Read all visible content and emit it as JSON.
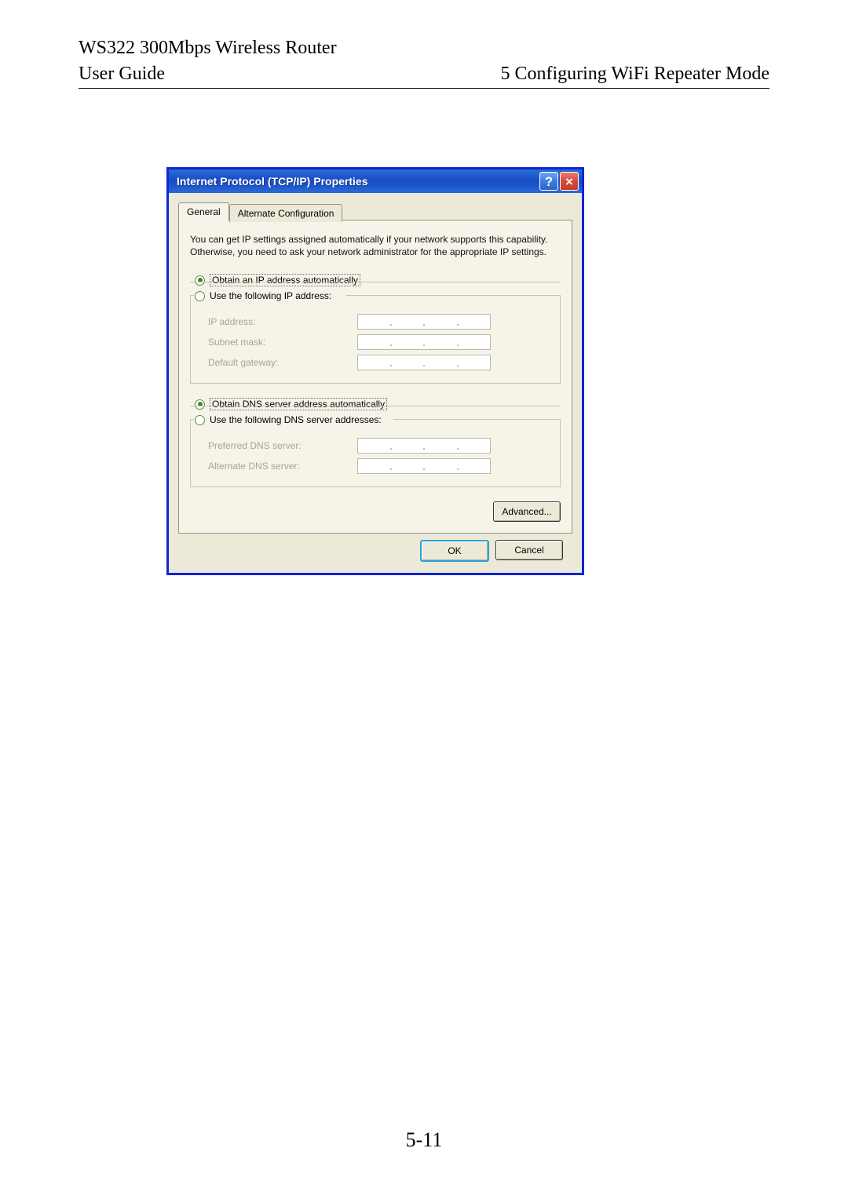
{
  "page": {
    "title_line": "WS322 300Mbps Wireless Router",
    "left_header": "User Guide",
    "right_header": "5 Configuring WiFi Repeater Mode",
    "page_number": "5-11"
  },
  "dialog": {
    "title": "Internet Protocol (TCP/IP) Properties",
    "tabs": {
      "general": "General",
      "alt": "Alternate Configuration"
    },
    "description": "You can get IP settings assigned automatically if your network supports this capability. Otherwise, you need to ask your network administrator for the appropriate IP settings.",
    "ip_group": {
      "auto": "Obtain an IP address automatically",
      "manual": "Use the following IP address:",
      "fields": {
        "ip": "IP address:",
        "mask": "Subnet mask:",
        "gateway": "Default gateway:"
      }
    },
    "dns_group": {
      "auto": "Obtain DNS server address automatically",
      "manual": "Use the following DNS server addresses:",
      "fields": {
        "preferred": "Preferred DNS server:",
        "alternate": "Alternate DNS server:"
      }
    },
    "buttons": {
      "advanced": "Advanced...",
      "ok": "OK",
      "cancel": "Cancel"
    }
  }
}
